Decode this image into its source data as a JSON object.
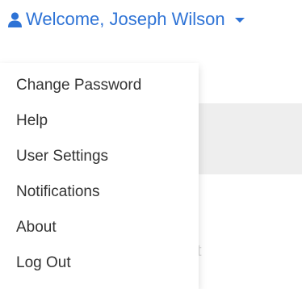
{
  "header": {
    "welcome_label": "Welcome, Joseph Wilson",
    "user_icon": "user-icon",
    "caret_icon": "caret-down-icon"
  },
  "menu": {
    "items": [
      {
        "label": "Change Password"
      },
      {
        "label": "Help"
      },
      {
        "label": "User Settings"
      },
      {
        "label": "Notifications"
      },
      {
        "label": "About"
      },
      {
        "label": "Log Out"
      }
    ]
  },
  "background": {
    "faint_text": "t"
  },
  "colors": {
    "accent": "#2e73d6",
    "menu_text": "#333333",
    "background_panel": "#eeeeee"
  }
}
